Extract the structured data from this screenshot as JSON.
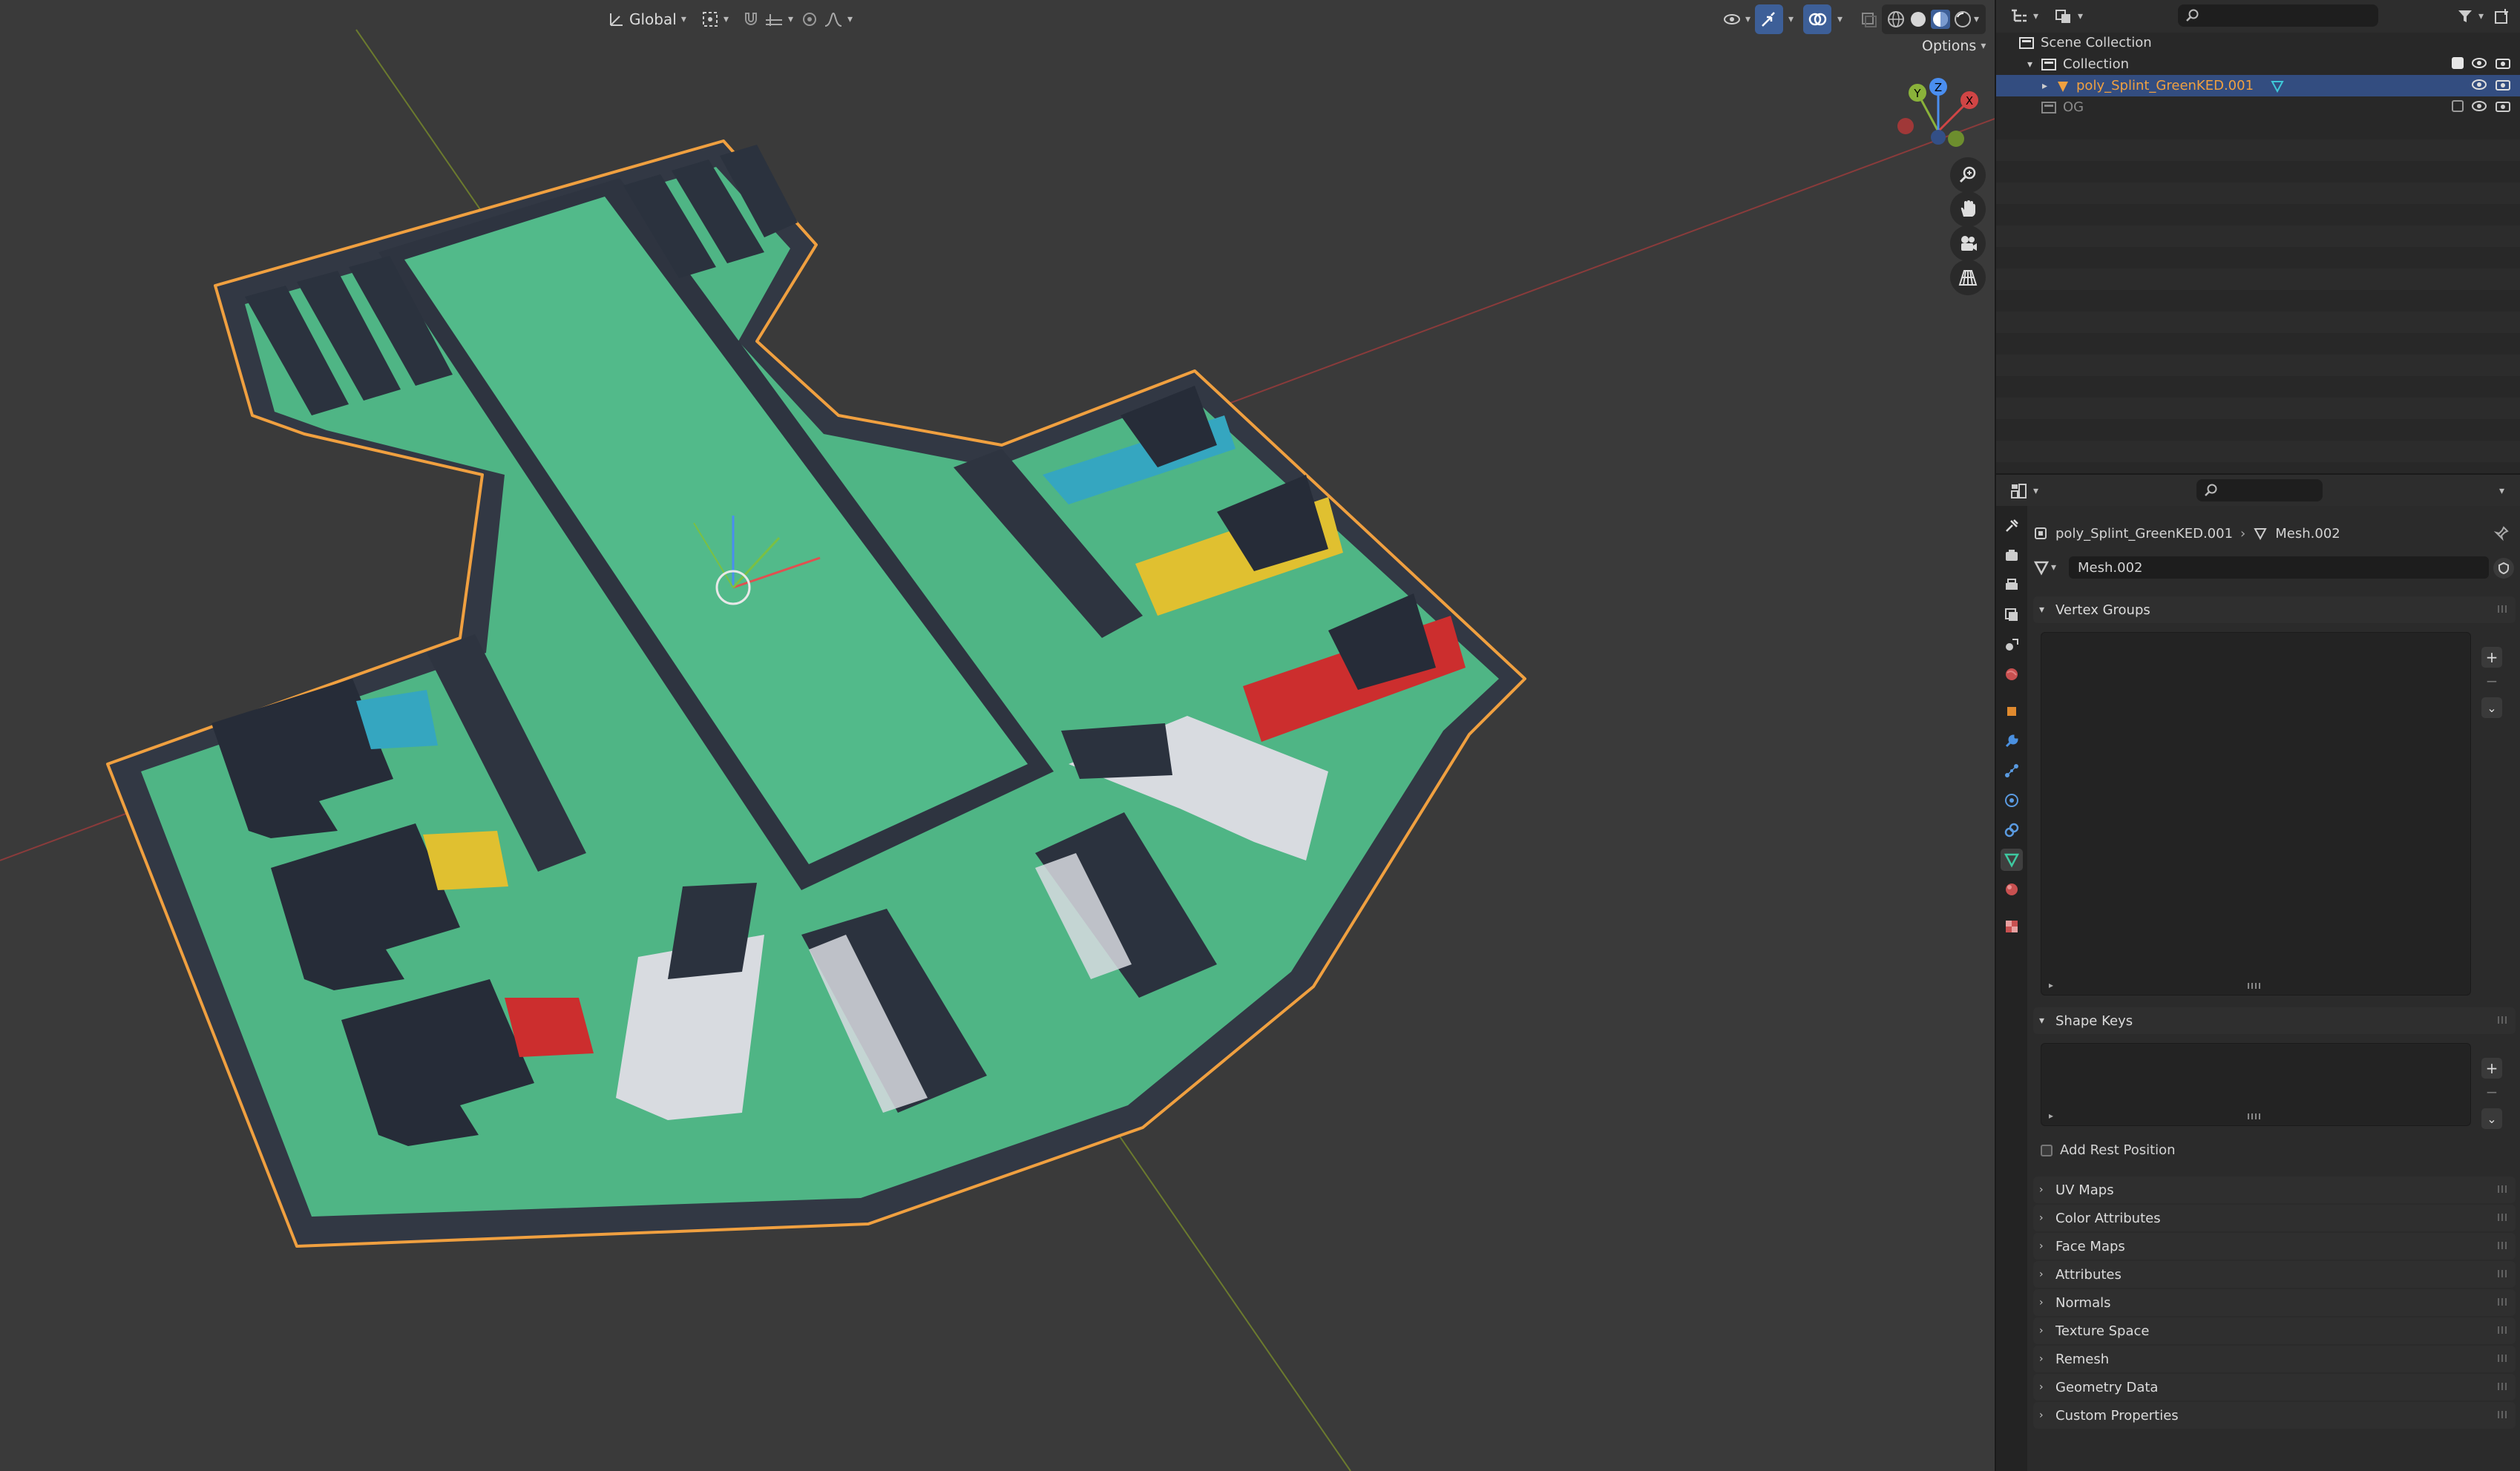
{
  "viewport": {
    "header": {
      "transform_orientation": "Global",
      "options_label": "Options"
    },
    "gizmo": {
      "y_label": "Y",
      "z_label": "Z",
      "x_label": "X"
    }
  },
  "outliner": {
    "rows": [
      {
        "label": "Scene Collection"
      },
      {
        "label": "Collection"
      },
      {
        "label": "poly_Splint_GreenKED.001"
      },
      {
        "label": "OG"
      }
    ]
  },
  "properties": {
    "breadcrumb": {
      "object": "poly_Splint_GreenKED.001",
      "mesh": "Mesh.002"
    },
    "mesh_name": "Mesh.002",
    "panels": {
      "vertex_groups": "Vertex Groups",
      "shape_keys": "Shape Keys",
      "add_rest_position": "Add Rest Position"
    },
    "collapsed_panels": [
      "UV Maps",
      "Color Attributes",
      "Face Maps",
      "Attributes",
      "Normals",
      "Texture Space",
      "Remesh",
      "Geometry Data",
      "Custom Properties"
    ]
  },
  "colors": {
    "selection_outline": "#f0a040",
    "splint_green": "#4fb585",
    "strap_dark": "#2b323e",
    "clip_cyan": "#35a6c0",
    "clip_yellow": "#e0c030",
    "clip_red": "#cc2e2e",
    "axis_red": "#d04545",
    "axis_green": "#8ab23a",
    "active_row": "#334d80"
  }
}
